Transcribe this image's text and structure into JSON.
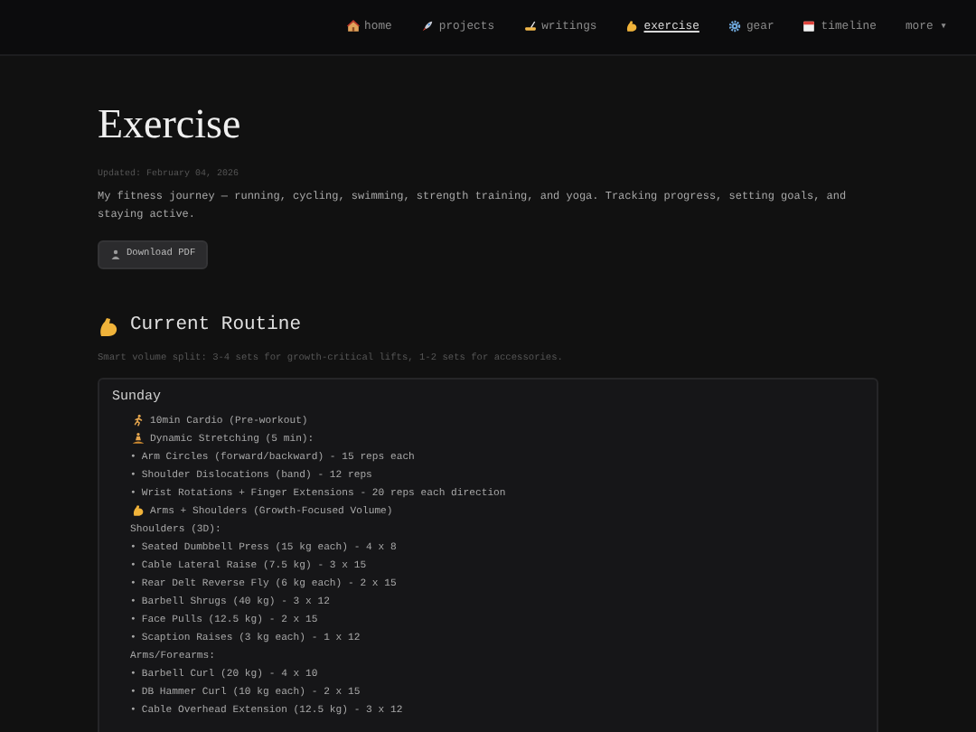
{
  "nav": [
    {
      "label": "home",
      "selected": false
    },
    {
      "label": "projects",
      "selected": false
    },
    {
      "label": "writings",
      "selected": false
    },
    {
      "label": "exercise",
      "selected": true
    },
    {
      "label": "gear",
      "selected": false
    },
    {
      "label": "timeline",
      "selected": false
    },
    {
      "label": "more ▾",
      "selected": false
    }
  ],
  "title": "Exercise",
  "updated": "Updated: February 04, 2026",
  "description": "My fitness journey — running, cycling, swimming, strength training, and yoga. Tracking progress, setting goals, and staying active.",
  "download_button": "Download PDF",
  "section": {
    "title": "Current Routine",
    "subtitle": "Smart volume split: 3-4 sets for growth-critical lifts, 1-2 sets for accessories."
  },
  "routine": {
    "day": "Sunday",
    "lines": [
      {
        "kind": "cardio",
        "text": "10min Cardio (Pre-workout)"
      },
      {
        "kind": "stretch",
        "text": "Dynamic Stretching (5 min):"
      },
      {
        "kind": "bullet",
        "bullet": "•",
        "text": "Arm Circles (forward/backward) - 15 reps each"
      },
      {
        "kind": "bullet",
        "bullet": "•",
        "text": "Shoulder Dislocations (band) - 12 reps"
      },
      {
        "kind": "bullet",
        "bullet": "•",
        "text": "Wrist Rotations + Finger Extensions - 20 reps each direction"
      },
      {
        "kind": "focus",
        "text": "Arms + Shoulders (Growth-Focused Volume)"
      },
      {
        "kind": "heading",
        "text": "Shoulders (3D):"
      },
      {
        "kind": "bullet",
        "bullet": "•",
        "text": "Seated Dumbbell Press (15 kg each) - 4 x 8"
      },
      {
        "kind": "bullet",
        "bullet": "•",
        "text": "Cable Lateral Raise (7.5 kg) - 3 x 15"
      },
      {
        "kind": "bullet",
        "bullet": "•",
        "text": "Rear Delt Reverse Fly (6 kg each) - 2 x 15"
      },
      {
        "kind": "bullet",
        "bullet": "•",
        "text": "Barbell Shrugs (40 kg) - 3 x 12"
      },
      {
        "kind": "bullet",
        "bullet": "•",
        "text": "Face Pulls (12.5 kg) - 2 x 15"
      },
      {
        "kind": "bullet",
        "bullet": "•",
        "text": "Scaption Raises (3 kg each) - 1 x 12"
      },
      {
        "kind": "heading",
        "text": "Arms/Forearms:"
      },
      {
        "kind": "bullet",
        "bullet": "•",
        "text": "Barbell Curl (20 kg) - 4 x 10"
      },
      {
        "kind": "bullet",
        "bullet": "•",
        "text": "DB Hammer Curl (10 kg each) - 2 x 15"
      },
      {
        "kind": "bullet",
        "bullet": "•",
        "text": "Cable Overhead Extension (12.5 kg) - 3 x 12"
      }
    ]
  }
}
